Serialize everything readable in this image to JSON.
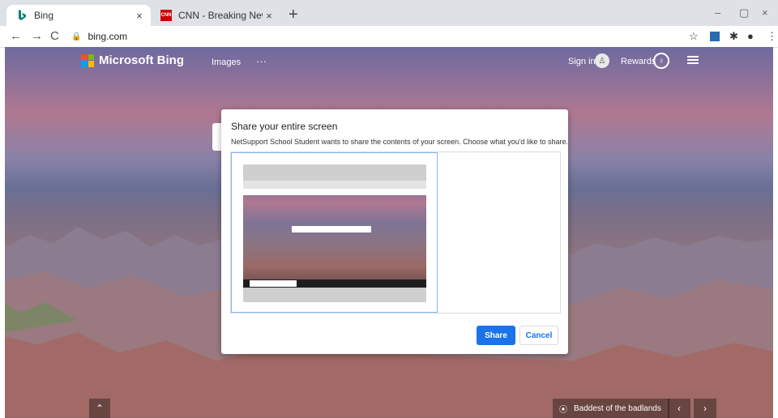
{
  "browser": {
    "tabs": [
      {
        "title": "Bing",
        "icon": "bing-favicon",
        "active": true
      },
      {
        "title": "CNN - Breaking News, Latest Ne",
        "icon": "cnn-favicon",
        "active": false
      }
    ],
    "new_tab_label": "+",
    "close_label": "×",
    "window": {
      "minimize": "–",
      "restore": "▢",
      "close": "×"
    },
    "url": "bing.com"
  },
  "bing": {
    "logo_text": "Microsoft Bing",
    "nav_images": "Images",
    "nav_more": "···",
    "sign_in": "Sign in",
    "rewards": "Rewards",
    "image_caption": "Baddest of the badlands",
    "colors": {
      "ms_red": "#f25022",
      "ms_green": "#7fba00",
      "ms_blue": "#00a4ef",
      "ms_yellow": "#ffb900"
    }
  },
  "dialog": {
    "title": "Share your entire screen",
    "description": "NetSupport School Student wants to share the contents of your screen. Choose what you'd like to share.",
    "share_label": "Share",
    "cancel_label": "Cancel",
    "accent": "#1a73e8"
  }
}
